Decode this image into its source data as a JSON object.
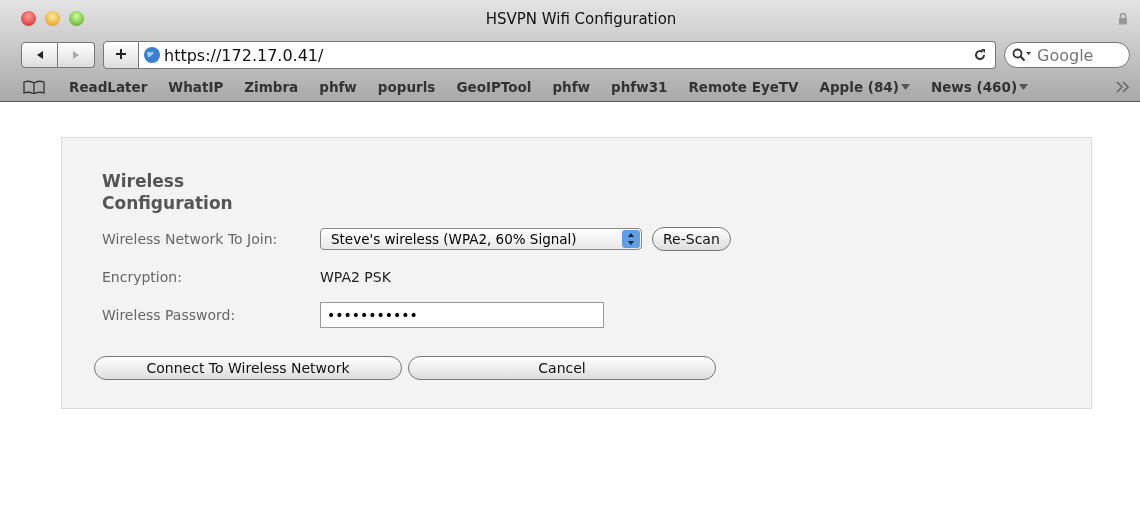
{
  "window": {
    "title": "HSVPN Wifi Configuration"
  },
  "toolbar": {
    "url": "https://172.17.0.41/",
    "search": {
      "placeholder": "Google"
    }
  },
  "bookmarks": [
    {
      "label": "ReadLater",
      "menu": false
    },
    {
      "label": "WhatIP",
      "menu": false
    },
    {
      "label": "Zimbra",
      "menu": false
    },
    {
      "label": "phfw",
      "menu": false
    },
    {
      "label": "popurls",
      "menu": false
    },
    {
      "label": "GeoIPTool",
      "menu": false
    },
    {
      "label": "phfw",
      "menu": false
    },
    {
      "label": "phfw31",
      "menu": false
    },
    {
      "label": "Remote EyeTV",
      "menu": false
    },
    {
      "label": "Apple (84)",
      "menu": true
    },
    {
      "label": "News (460)",
      "menu": true
    }
  ],
  "form": {
    "title": "Wireless Configuration",
    "network": {
      "label": "Wireless Network To Join:",
      "value": "Steve's wireless (WPA2, 60% Signal)",
      "rescan": "Re-Scan"
    },
    "encryption": {
      "label": "Encryption:",
      "value": "WPA2 PSK"
    },
    "password": {
      "label": "Wireless Password:",
      "value": "•••••••••••"
    },
    "buttons": [
      "Connect To Wireless Network",
      "Cancel"
    ]
  }
}
